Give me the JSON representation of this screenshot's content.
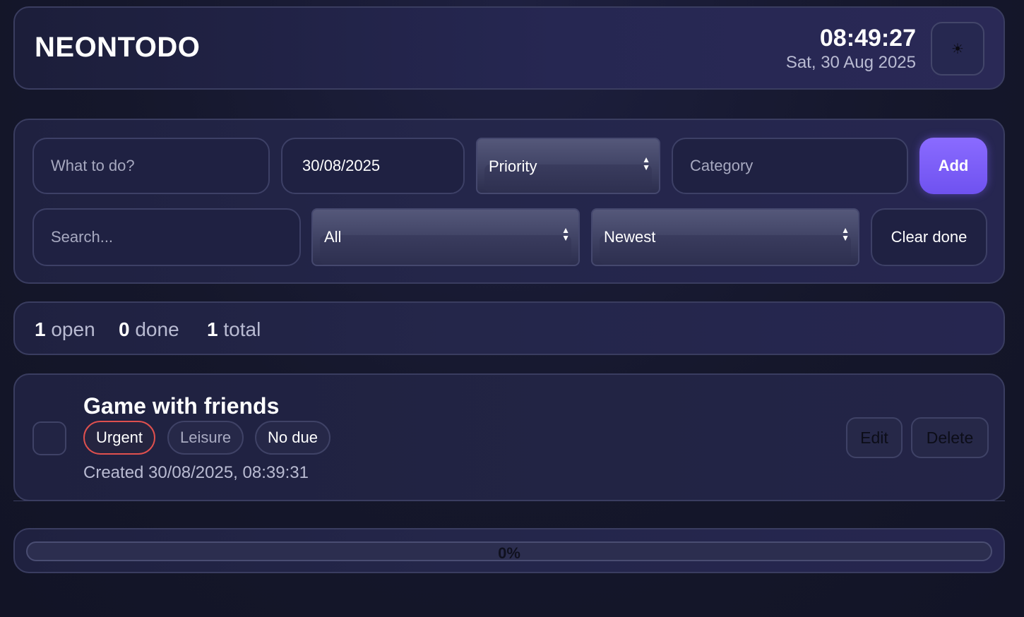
{
  "header": {
    "brand": "NEONTODO",
    "time": "08:49:27",
    "date": "Sat, 30 Aug 2025",
    "theme_icon": "☀"
  },
  "form": {
    "task_placeholder": "What to do?",
    "due_date": "30/08/2025",
    "priority_selected": "Priority",
    "category_placeholder": "Category",
    "add_label": "Add",
    "search_placeholder": "Search...",
    "filter_selected": "All",
    "sort_selected": "Newest",
    "clear_label": "Clear done"
  },
  "stats": {
    "open_count": "1",
    "open_label": "open",
    "done_count": "0",
    "done_label": "done",
    "total_count": "1",
    "total_label": "total"
  },
  "todos": [
    {
      "title": "Game with friends",
      "priority": "Urgent",
      "category": "Leisure",
      "due": "No due",
      "created": "Created 30/08/2025, 08:39:31",
      "edit_label": "Edit",
      "delete_label": "Delete",
      "done": false
    }
  ],
  "progress": {
    "percent": 0,
    "label": "0%"
  },
  "colors": {
    "accent": "#7b5cff",
    "urgent": "#e0504e",
    "background": "#141629"
  }
}
